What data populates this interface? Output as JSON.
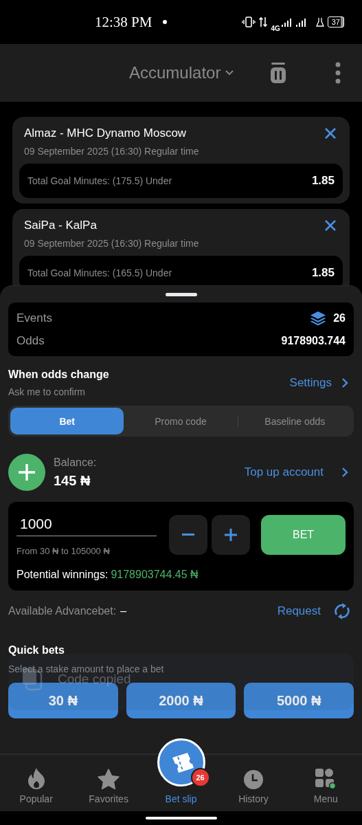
{
  "status_bar": {
    "time": "12:38 PM",
    "network": "4G",
    "battery": "37"
  },
  "header": {
    "title": "Accumulator"
  },
  "events": [
    {
      "match": "Almaz - MHC Dynamo Moscow",
      "date": "09 September 2025 (16:30) Regular time",
      "market": "Total Goal Minutes: (175.5) Under",
      "odds": "1.85"
    },
    {
      "match": "SaiPa - KalPa",
      "date": "09 September 2025 (16:30) Regular time",
      "market": "Total Goal Minutes: (165.5) Under",
      "odds": "1.85"
    }
  ],
  "summary": {
    "events_label": "Events",
    "events_count": "26",
    "odds_label": "Odds",
    "odds_value": "9178903.744"
  },
  "odds_change": {
    "title": "When odds change",
    "subtitle": "Ask me to confirm",
    "link": "Settings"
  },
  "tabs": [
    {
      "label": "Bet",
      "selected": true
    },
    {
      "label": "Promo code",
      "selected": false
    },
    {
      "label": "Baseline odds",
      "selected": false
    }
  ],
  "balance": {
    "label": "Balance:",
    "amount": "145 ₦",
    "link": "Top up account"
  },
  "stake": {
    "value": "1000",
    "range": "From 30 ₦ to 105000 ₦",
    "bet_button": "BET",
    "winnings_label": "Potential winnings:",
    "winnings_value": "9178903744.45 ₦"
  },
  "advancebet": {
    "label": "Available Advancebet:",
    "value": "–",
    "link": "Request"
  },
  "quick_bets": {
    "title": "Quick bets",
    "subtitle": "Select a stake amount to place a bet",
    "amounts": [
      "30 ₦",
      "2000 ₦",
      "5000 ₦"
    ]
  },
  "toast": {
    "text": "Code copied"
  },
  "nav": [
    {
      "label": "Popular",
      "kind": "flame",
      "selected": false
    },
    {
      "label": "Favorites",
      "kind": "star",
      "selected": false
    },
    {
      "label": "Bet slip",
      "kind": "ticket",
      "selected": true,
      "badge": "26"
    },
    {
      "label": "History",
      "kind": "clock",
      "selected": false
    },
    {
      "label": "Menu",
      "kind": "grid",
      "selected": false
    }
  ]
}
